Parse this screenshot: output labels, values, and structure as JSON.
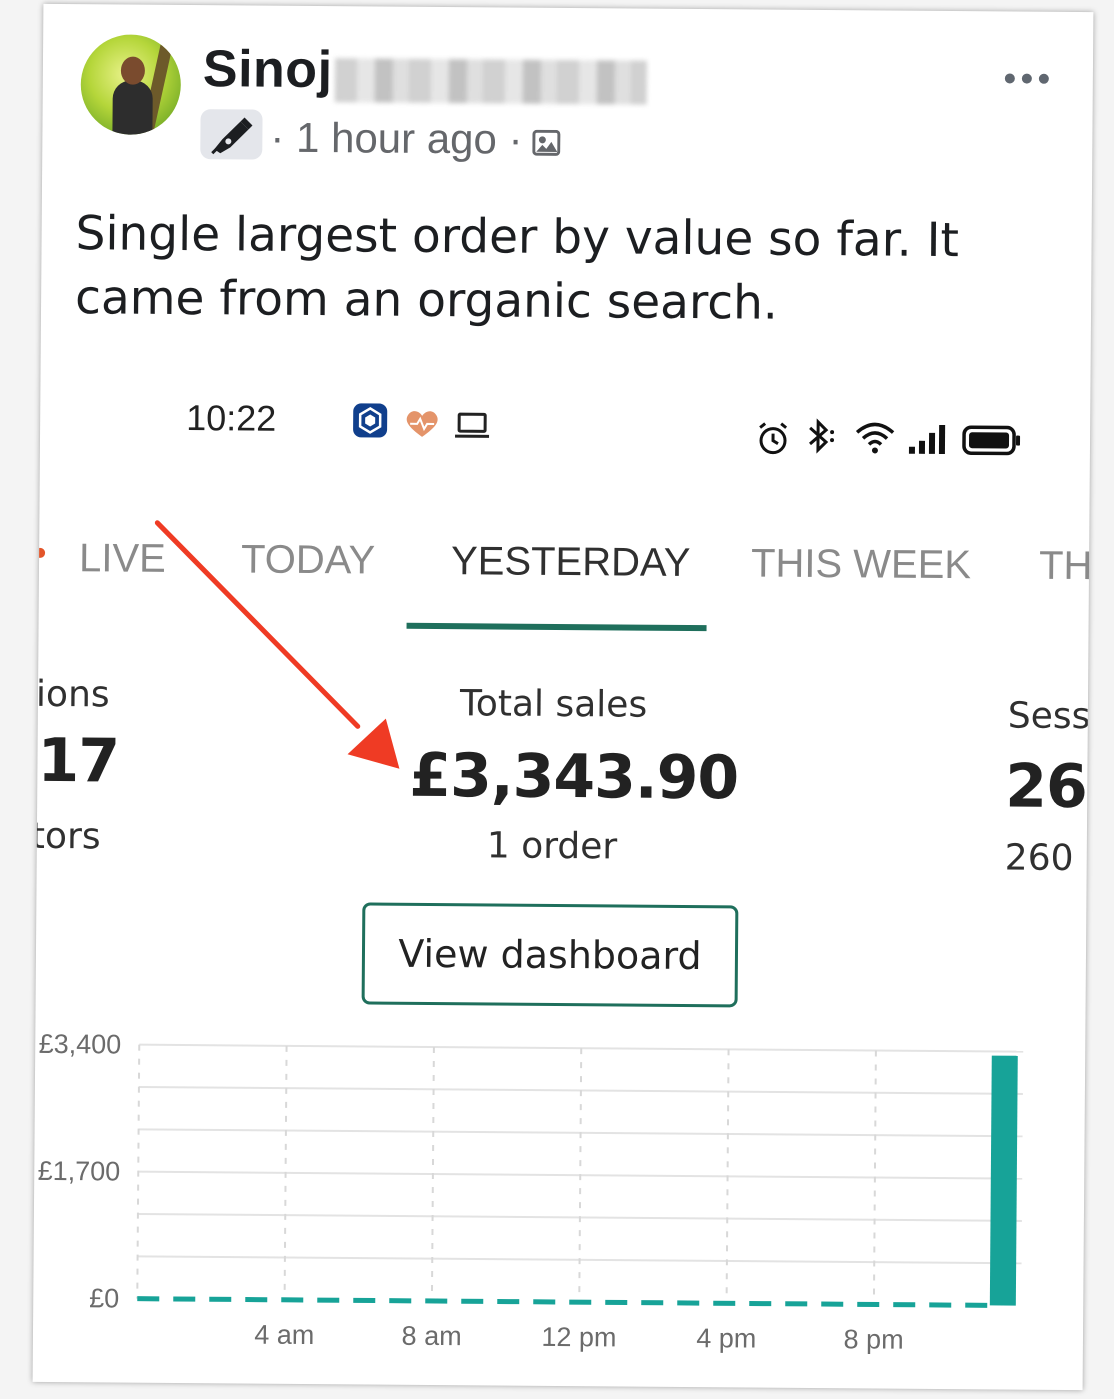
{
  "post": {
    "author_name": "Sinoj",
    "time_ago": "1 hour ago",
    "separator": "·",
    "text": "Single largest order by value so far. It came from an organic search."
  },
  "phone": {
    "status_time": "10:22"
  },
  "tabs": [
    {
      "label": "LIVE"
    },
    {
      "label": "TODAY"
    },
    {
      "label": "YESTERDAY",
      "active": true
    },
    {
      "label": "THIS WEEK"
    },
    {
      "label": "TH"
    }
  ],
  "metrics": {
    "left": {
      "label": "ions",
      "value": "17",
      "sub": "tors"
    },
    "center": {
      "label": "Total sales",
      "value": "£3,343.90",
      "sub": "1 order"
    },
    "right": {
      "label": "Sess",
      "value": "26",
      "sub": "260"
    }
  },
  "view_dashboard_label": "View dashboard",
  "colors": {
    "accent": "#1f6f5c",
    "bar": "#17a398",
    "arrow": "#ef3b24"
  },
  "chart_data": {
    "type": "bar",
    "title": "",
    "xlabel": "",
    "ylabel": "",
    "ylim": [
      0,
      3400
    ],
    "yticks": [
      "£0",
      "£1,700",
      "£3,400"
    ],
    "ytick_values": [
      0,
      1700,
      3400
    ],
    "xtick_labels": [
      "4 am",
      "8 am",
      "12 pm",
      "4 pm",
      "8 pm"
    ],
    "xtick_hours": [
      4,
      8,
      12,
      16,
      20
    ],
    "x_range_hours": [
      0,
      24
    ],
    "bars": [
      {
        "hour": 23,
        "value": 3343.9
      }
    ],
    "baseline_style": "dashed",
    "grid": true
  }
}
